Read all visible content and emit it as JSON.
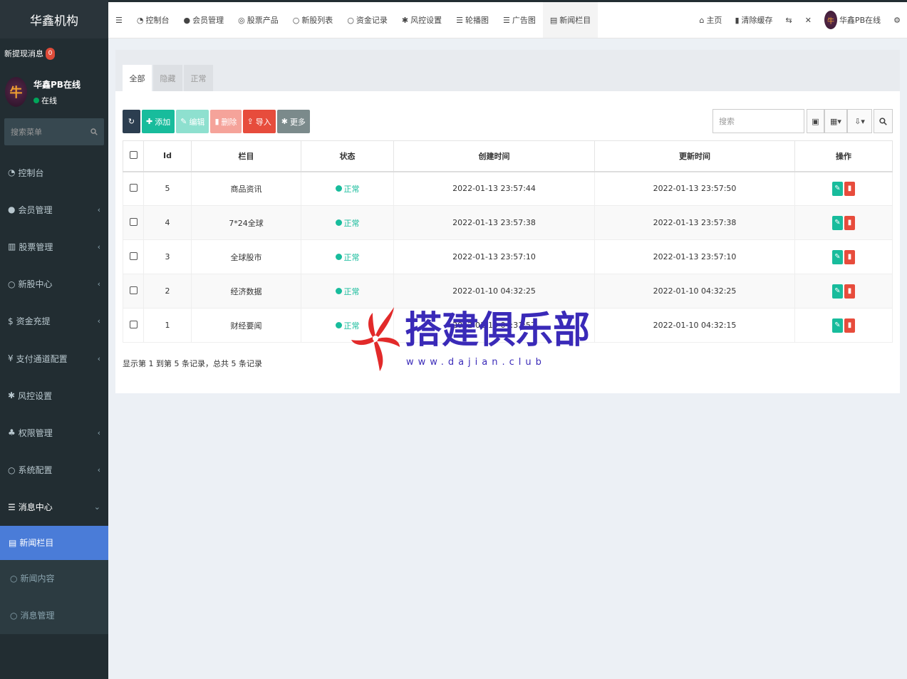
{
  "sidebar": {
    "logo": "华鑫机构",
    "notice_label": "新提现消息",
    "notice_count": "0",
    "user_name": "华鑫PB在线",
    "user_status": "在线",
    "search_placeholder": "搜索菜单",
    "items": [
      {
        "icon": "dashboard-icon",
        "label": "控制台",
        "caret": ""
      },
      {
        "icon": "user-icon",
        "label": "会员管理",
        "caret": "‹"
      },
      {
        "icon": "bank-icon",
        "label": "股票管理",
        "caret": "‹"
      },
      {
        "icon": "circle-icon",
        "label": "新股中心",
        "caret": "‹"
      },
      {
        "icon": "dollar-icon",
        "label": "资金充提",
        "caret": "‹"
      },
      {
        "icon": "yen-icon",
        "label": "支付通道配置",
        "caret": "‹"
      },
      {
        "icon": "gear-icon",
        "label": "风控设置",
        "caret": ""
      },
      {
        "icon": "users-icon",
        "label": "权限管理",
        "caret": "‹"
      },
      {
        "icon": "cog-icon",
        "label": "系统配置",
        "caret": "‹"
      },
      {
        "icon": "list-icon",
        "label": "消息中心",
        "caret": "⌄"
      }
    ],
    "subitems": [
      {
        "label": "新闻栏目",
        "active": true
      },
      {
        "label": "新闻内容",
        "active": false
      },
      {
        "label": "消息管理",
        "active": false
      }
    ]
  },
  "topbar": {
    "tabs": [
      "控制台",
      "会员管理",
      "股票产品",
      "新股列表",
      "资金记录",
      "风控设置",
      "轮播图",
      "广告图",
      "新闻栏目"
    ],
    "right": {
      "home": "主页",
      "clear_cache": "清除缓存",
      "user": "华鑫PB在线"
    }
  },
  "panel": {
    "tabs": [
      "全部",
      "隐藏",
      "正常"
    ],
    "toolbar": {
      "add": "添加",
      "edit": "编辑",
      "delete": "删除",
      "import": "导入",
      "more": "更多"
    },
    "search_placeholder": "搜索",
    "columns": [
      "Id",
      "栏目",
      "状态",
      "创建时间",
      "更新时间",
      "操作"
    ],
    "rows": [
      {
        "id": "5",
        "name": "商品资讯",
        "status": "正常",
        "created": "2022-01-13 23:57:44",
        "updated": "2022-01-13 23:57:50"
      },
      {
        "id": "4",
        "name": "7*24全球",
        "status": "正常",
        "created": "2022-01-13 23:57:38",
        "updated": "2022-01-13 23:57:38"
      },
      {
        "id": "3",
        "name": "全球股市",
        "status": "正常",
        "created": "2022-01-13 23:57:10",
        "updated": "2022-01-13 23:57:10"
      },
      {
        "id": "2",
        "name": "经济数据",
        "status": "正常",
        "created": "2022-01-10 04:32:25",
        "updated": "2022-01-10 04:32:25"
      },
      {
        "id": "1",
        "name": "财经要闻",
        "status": "正常",
        "created": "2022-01-10 04:31:57",
        "updated": "2022-01-10 04:32:15"
      }
    ],
    "pager_text": "显示第 1 到第 5 条记录，总共 5 条记录"
  },
  "watermark": {
    "title": "搭建俱乐部",
    "url": "www.dajian.club"
  }
}
